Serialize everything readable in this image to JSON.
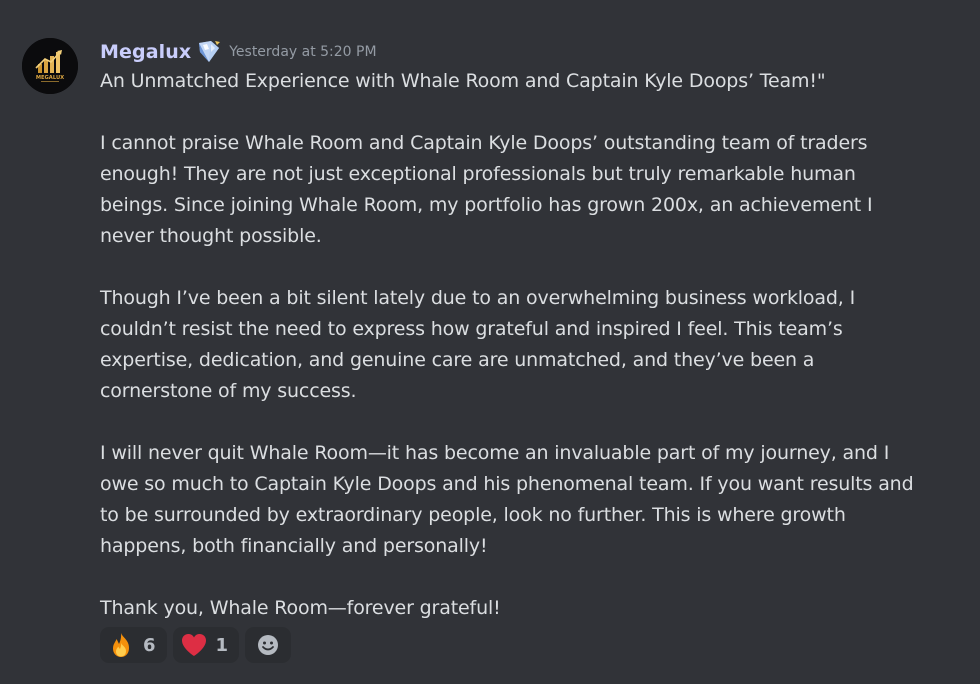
{
  "message": {
    "author": "Megalux",
    "avatar_text": "MEGALUX",
    "timestamp": "Yesterday at 5:20 PM",
    "paragraphs": [
      "An Unmatched Experience with Whale Room and Captain Kyle Doops’ Team!\"",
      "I cannot praise Whale Room and Captain Kyle Doops’ outstanding team of traders\nenough! They are not just exceptional professionals but truly remarkable human\nbeings. Since joining Whale Room, my portfolio has grown 200x, an achievement I\nnever thought possible.",
      "Though I’ve been a bit silent lately due to an overwhelming business workload, I\ncouldn’t resist the need to express how grateful and inspired I feel. This team’s\nexpertise, dedication, and genuine care are unmatched, and they’ve been a\ncornerstone of my success.",
      "I will never quit Whale Room—it has become an invaluable part of my journey, and I\nowe so much to Captain Kyle Doops and his phenomenal team. If you want results and\nto be surrounded by extraordinary people, look no further. This is where growth\nhappens, both financially and personally!",
      "Thank you, Whale Room—forever grateful!"
    ]
  },
  "reactions": [
    {
      "icon": "fire-emoji-icon",
      "count": "6"
    },
    {
      "icon": "heart-emoji-icon",
      "count": "1"
    }
  ],
  "colors": {
    "background": "#313338",
    "username": "#c9cdfb",
    "text": "#dbdee1",
    "timestamp": "#949ba4",
    "reaction_bg": "#2b2d31",
    "gold": "#d9a441"
  }
}
